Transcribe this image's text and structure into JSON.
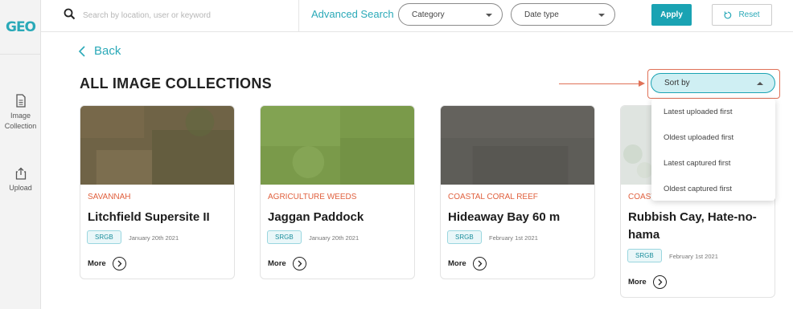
{
  "sidebar": {
    "logo": "GEO",
    "items": [
      {
        "label_line1": "Image",
        "label_line2": "Collection",
        "icon": "document-icon"
      },
      {
        "label_line1": "Upload",
        "icon": "upload-icon"
      }
    ]
  },
  "topbar": {
    "search_placeholder": "Search by location, user or keyword",
    "advanced_search": "Advanced Search",
    "category": "Category",
    "date_type": "Date type",
    "apply": "Apply",
    "reset": "Reset"
  },
  "main": {
    "back": "Back",
    "title": "ALL IMAGE COLLECTIONS",
    "sort": {
      "label": "Sort by",
      "options": [
        "Latest uploaded first",
        "Oldest uploaded first",
        "Latest captured first",
        "Oldest captured first"
      ]
    },
    "cards": [
      {
        "category": "SAVANNAH",
        "title": "Litchfield Supersite II",
        "badge": "SRGB",
        "date": "January 20th 2021",
        "more": "More"
      },
      {
        "category": "AGRICULTURE WEEDS",
        "title": "Jaggan Paddock",
        "badge": "SRGB",
        "date": "January 20th 2021",
        "more": "More"
      },
      {
        "category": "COASTAL CORAL REEF",
        "title": "Hideaway Bay 60 m",
        "badge": "SRGB",
        "date": "February 1st 2021",
        "more": "More"
      },
      {
        "category": "COAST",
        "title": "Rubbish Cay, Hate-no-hama",
        "badge": "SRGB",
        "date": "February 1st 2021",
        "more": "More"
      }
    ]
  },
  "colors": {
    "accent": "#1aa3b3",
    "category": "#e0603e",
    "annotation": "#e07258"
  }
}
